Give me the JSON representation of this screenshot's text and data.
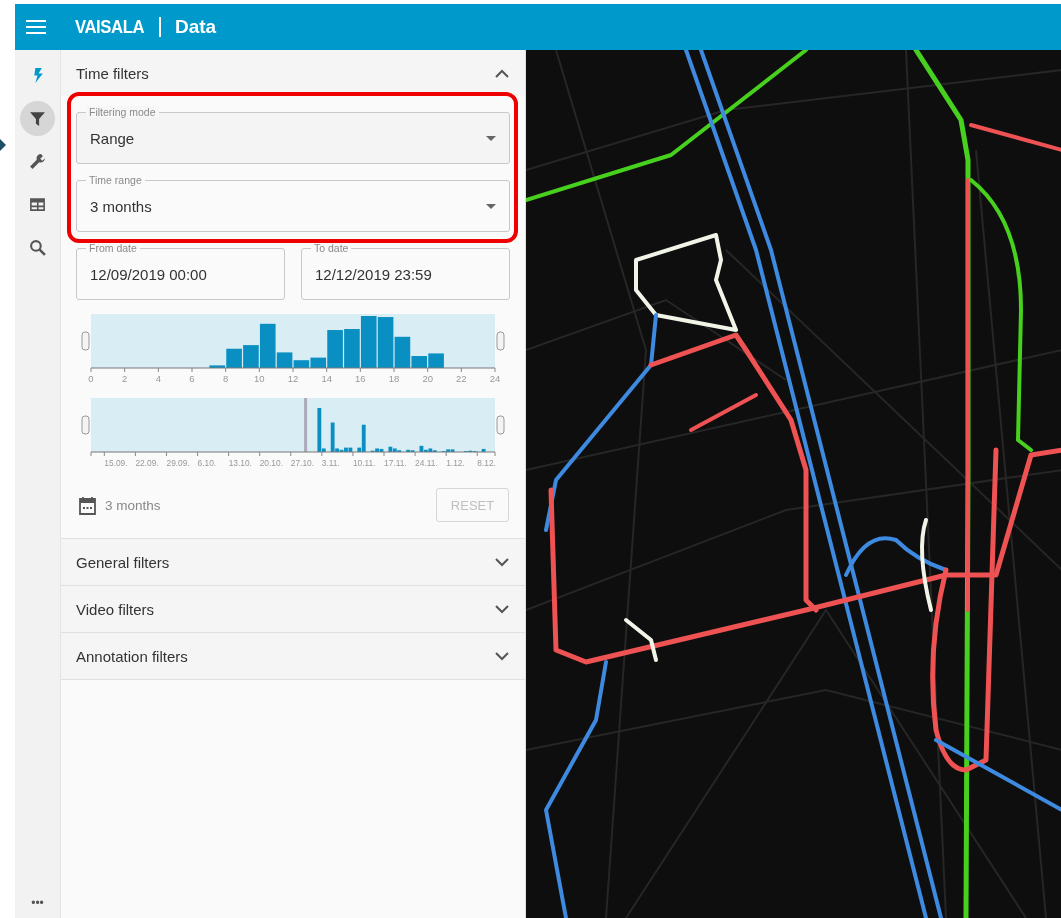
{
  "header": {
    "logo": "VAISALA",
    "title": "Data"
  },
  "rail": {
    "items": [
      {
        "kind": "bolt",
        "selected": false
      },
      {
        "kind": "filter",
        "selected": true
      },
      {
        "kind": "wrench",
        "selected": false
      },
      {
        "kind": "table",
        "selected": false
      },
      {
        "kind": "search",
        "selected": false
      }
    ],
    "more": "•••"
  },
  "sections": [
    {
      "title": "Time filters",
      "expanded": true,
      "filtering_mode": {
        "label": "Filtering mode",
        "value": "Range"
      },
      "time_range": {
        "label": "Time range",
        "value": "3 months"
      },
      "from_date": {
        "label": "From date",
        "value": "12/09/2019 00:00"
      },
      "to_date": {
        "label": "To date",
        "value": "12/12/2019 23:59"
      },
      "hour_histogram": {
        "axis_labels": [
          "0",
          "2",
          "4",
          "6",
          "8",
          "10",
          "12",
          "14",
          "16",
          "18",
          "20",
          "22",
          "24"
        ]
      },
      "date_histogram": {
        "axis_labels": [
          "15.09.",
          "22.09.",
          "29.09.",
          "6.10.",
          "13.10.",
          "20.10.",
          "27.10.",
          "3.11.",
          "10.11.",
          "17.11.",
          "24.11.",
          "1.12.",
          "8.12."
        ]
      },
      "summary": "3 months",
      "reset_button": {
        "label": "RESET",
        "disabled": true
      }
    },
    {
      "title": "General filters",
      "expanded": false
    },
    {
      "title": "Video filters",
      "expanded": false
    },
    {
      "title": "Annotation filters",
      "expanded": false
    }
  ]
}
